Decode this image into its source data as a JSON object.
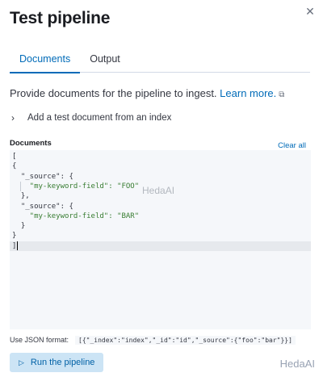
{
  "flyout": {
    "title": "Test pipeline",
    "close_icon": "close-icon"
  },
  "tabs": [
    {
      "label": "Documents",
      "active": true
    },
    {
      "label": "Output",
      "active": false
    }
  ],
  "description": {
    "text": "Provide documents for the pipeline to ingest.",
    "link_label": "Learn more.",
    "link_icon": "external-link-icon"
  },
  "accordion": {
    "label": "Add a test document from an index",
    "icon": "chevron-right-icon"
  },
  "documents": {
    "label": "Documents",
    "clear_label": "Clear all",
    "lines": [
      "[",
      "{",
      "  \"_source\": {",
      "    \"my-keyword-field\": \"FOO\"",
      "  },",
      "  \"_source\": {",
      "    \"my-keyword-field\": \"BAR\"",
      "  }",
      "}",
      "]"
    ]
  },
  "help": {
    "label": "Use JSON format:",
    "format": "[{\"_index\":\"index\",\"_id\":\"id\",\"_source\":{\"foo\":\"bar\"}}]"
  },
  "run_button": {
    "label": "Run the pipeline",
    "icon": "play-icon"
  },
  "watermarks": [
    "HedaAI",
    "HedaAI"
  ],
  "colors": {
    "accent": "#006bb8",
    "string": "#387d32",
    "button_bg": "#cce4f5"
  }
}
